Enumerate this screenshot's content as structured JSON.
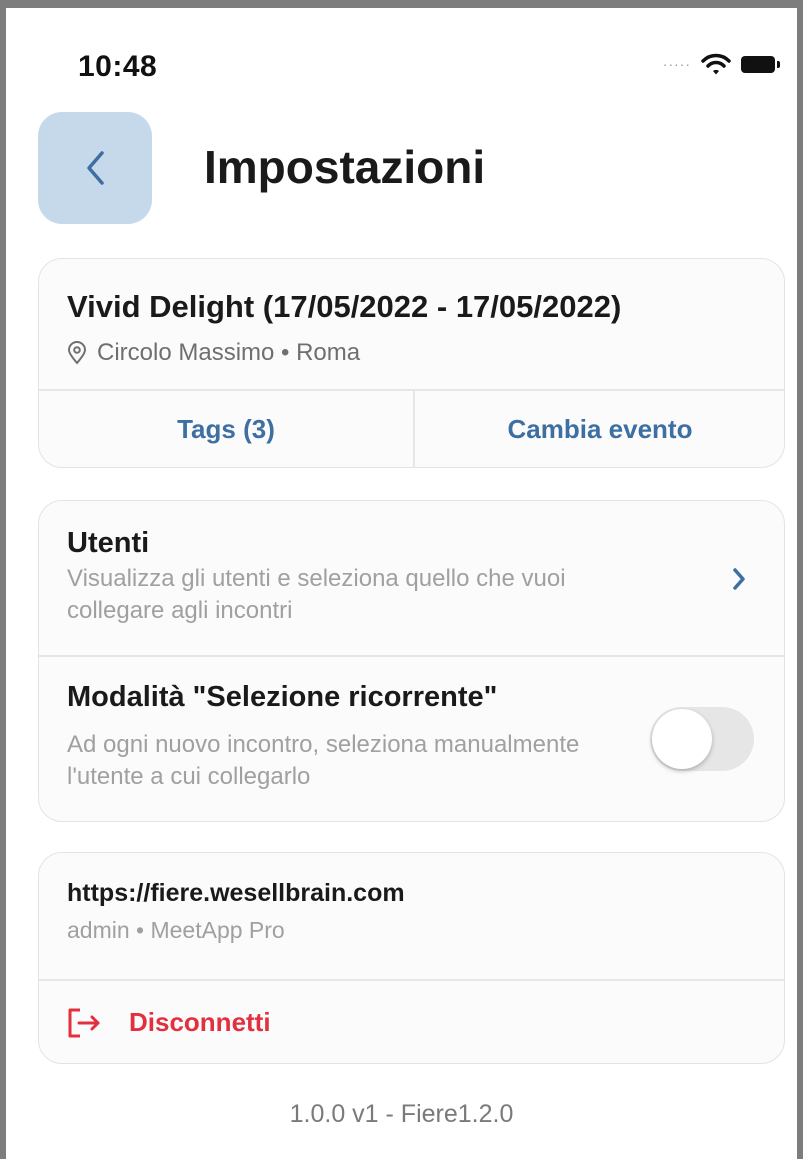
{
  "status_bar": {
    "time": "10:48",
    "signal_icon": "signal-dots-icon",
    "wifi_icon": "wifi-icon",
    "battery_icon": "battery-icon"
  },
  "header": {
    "back_icon": "chevron-left-icon",
    "title": "Impostazioni"
  },
  "event_card": {
    "title": "Vivid Delight (17/05/2022 - 17/05/2022)",
    "location": "Circolo Massimo • Roma",
    "location_icon": "location-pin-icon",
    "tags_label": "Tags (3)",
    "change_event_label": "Cambia evento"
  },
  "settings_card": {
    "users_title": "Utenti",
    "users_subtitle": "Visualizza gli utenti e seleziona quello che vuoi collegare agli incontri",
    "chevron_icon": "chevron-right-icon",
    "mode_title": "Modalità \"Selezione ricorrente\"",
    "mode_subtitle": "Ad ogni nuovo incontro, seleziona manualmente l'utente a cui collegarlo",
    "mode_enabled": false
  },
  "account_card": {
    "url": "https://fiere.wesellbrain.com",
    "account": "admin • MeetApp Pro",
    "logout_icon": "logout-icon",
    "logout_label": "Disconnetti"
  },
  "footer": {
    "version": "1.0.0 v1 -  Fiere1.2.0"
  },
  "colors": {
    "accent": "#3e6fa3",
    "back_button_bg": "#c6d9ea",
    "danger": "#e2303e",
    "muted_text": "#a0a0a0"
  }
}
